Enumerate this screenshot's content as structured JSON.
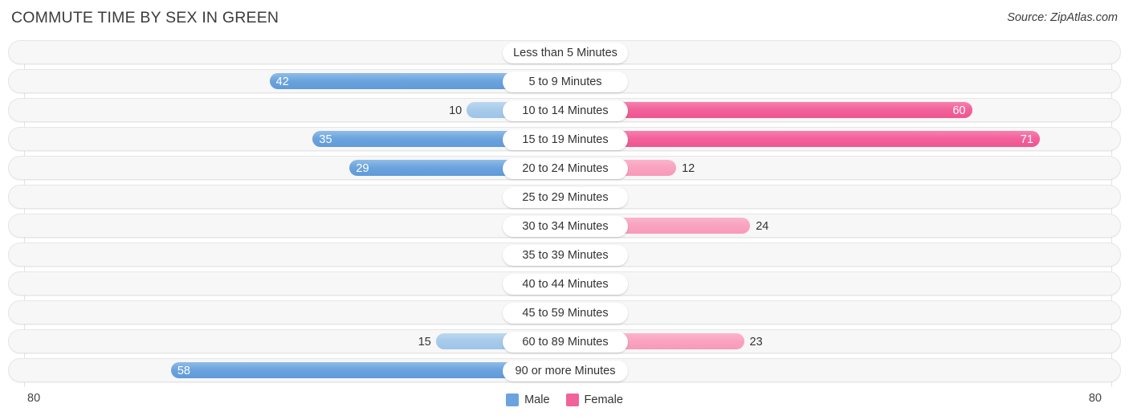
{
  "header": {
    "title": "COMMUTE TIME BY SEX IN GREEN",
    "source": "Source: ZipAtlas.com"
  },
  "axis": {
    "left_label": "80",
    "right_label": "80"
  },
  "legend": {
    "items": [
      {
        "label": "Male",
        "color": "#6BA3DE"
      },
      {
        "label": "Female",
        "color": "#F2629A"
      }
    ]
  },
  "chart_data": {
    "type": "bar",
    "title": "COMMUTE TIME BY SEX IN GREEN",
    "subtitle": "Source: ZipAtlas.com",
    "orientation": "horizontal",
    "style": "diverging-butterfly",
    "xlabel": "",
    "ylabel": "",
    "xlim": [
      80,
      80
    ],
    "axis_max": 80,
    "grid": true,
    "legend_position": "bottom-center",
    "categories": [
      "Less than 5 Minutes",
      "5 to 9 Minutes",
      "10 to 14 Minutes",
      "15 to 19 Minutes",
      "20 to 24 Minutes",
      "25 to 29 Minutes",
      "30 to 34 Minutes",
      "35 to 39 Minutes",
      "40 to 44 Minutes",
      "45 to 59 Minutes",
      "60 to 89 Minutes",
      "90 or more Minutes"
    ],
    "series": [
      {
        "name": "Male",
        "color": "#6BA3DE",
        "color_light": "#A8CBEB",
        "side": "left",
        "values": [
          0,
          42,
          10,
          35,
          29,
          0,
          0,
          0,
          0,
          0,
          15,
          58
        ]
      },
      {
        "name": "Female",
        "color": "#F2629A",
        "color_light": "#F9A3C0",
        "side": "right",
        "values": [
          0,
          0,
          60,
          71,
          12,
          0,
          24,
          0,
          0,
          0,
          23,
          0
        ]
      }
    ],
    "rows": [
      {
        "category": "Less than 5 Minutes",
        "male": 0,
        "female": 0,
        "male_text": "0",
        "female_text": "0"
      },
      {
        "category": "5 to 9 Minutes",
        "male": 42,
        "female": 0,
        "male_text": "42",
        "female_text": "0"
      },
      {
        "category": "10 to 14 Minutes",
        "male": 10,
        "female": 60,
        "male_text": "10",
        "female_text": "60"
      },
      {
        "category": "15 to 19 Minutes",
        "male": 35,
        "female": 71,
        "male_text": "35",
        "female_text": "71"
      },
      {
        "category": "20 to 24 Minutes",
        "male": 29,
        "female": 12,
        "male_text": "29",
        "female_text": "12"
      },
      {
        "category": "25 to 29 Minutes",
        "male": 0,
        "female": 0,
        "male_text": "0",
        "female_text": "0"
      },
      {
        "category": "30 to 34 Minutes",
        "male": 0,
        "female": 24,
        "male_text": "0",
        "female_text": "24"
      },
      {
        "category": "35 to 39 Minutes",
        "male": 0,
        "female": 0,
        "male_text": "0",
        "female_text": "0"
      },
      {
        "category": "40 to 44 Minutes",
        "male": 0,
        "female": 0,
        "male_text": "0",
        "female_text": "0"
      },
      {
        "category": "45 to 59 Minutes",
        "male": 0,
        "female": 0,
        "male_text": "0",
        "female_text": "0"
      },
      {
        "category": "60 to 89 Minutes",
        "male": 15,
        "female": 23,
        "male_text": "15",
        "female_text": "23"
      },
      {
        "category": "90 or more Minutes",
        "male": 58,
        "female": 0,
        "male_text": "58",
        "female_text": "0"
      }
    ]
  }
}
